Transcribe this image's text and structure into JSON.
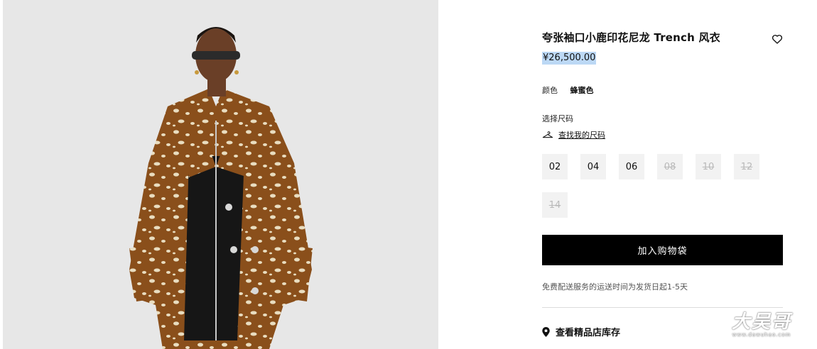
{
  "product": {
    "image_alt": "model-wearing-deer-print-trench-coat",
    "title": "夸张袖口小鹿印花尼龙 Trench 风衣",
    "price": "¥26,500.00",
    "color_label": "颜色",
    "color_value": "蜂蜜色"
  },
  "size": {
    "label": "选择尺码",
    "guide_link": "查找我的尺码",
    "options": [
      {
        "label": "02",
        "available": true
      },
      {
        "label": "04",
        "available": true
      },
      {
        "label": "06",
        "available": true
      },
      {
        "label": "08",
        "available": false
      },
      {
        "label": "10",
        "available": false
      },
      {
        "label": "12",
        "available": false
      },
      {
        "label": "14",
        "available": false
      }
    ]
  },
  "actions": {
    "add_to_bag": "加入购物袋",
    "store_stock": "查看精品店库存"
  },
  "delivery_note": "免费配送服务的运送时间为发货日起1-5天",
  "watermark": {
    "main": "大吴哥",
    "url": "www.dawuhao.com"
  },
  "colors": {
    "coat": "#8a4f1b",
    "spots": "#e9ddc0",
    "background": "#e7e7e7",
    "price_highlight": "#bcd8f5",
    "button": "#000000"
  }
}
